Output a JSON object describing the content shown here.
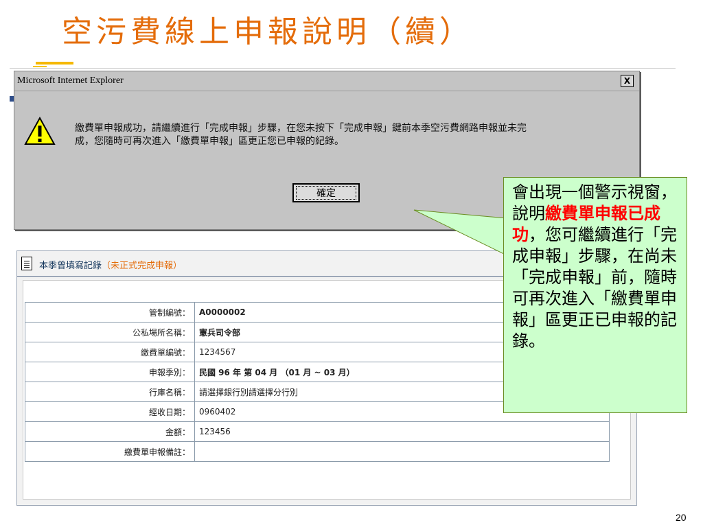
{
  "slide": {
    "title": "空污費線上申報說明（續）",
    "page_number": "20"
  },
  "dialog": {
    "title": "Microsoft Internet Explorer",
    "close_label": "X",
    "message_line1": "繳費單申報成功，請繼續進行「完成申報」步驟，在您未按下「完成申報」鍵前本季空污費網路申報並未完",
    "message_line2": "成，您隨時可再次進入「繳費單申報」區更正您已申報的紀錄。",
    "ok_label": "確定",
    "icon": "warning-icon"
  },
  "panel": {
    "title": "本季曾填寫記錄",
    "title_note": "（未正式完成申報）",
    "icon": "document-icon",
    "rows": [
      {
        "label": "管制編號：",
        "value": "A0000002"
      },
      {
        "label": "公私場所名稱：",
        "value": "憲兵司令部"
      },
      {
        "label": "繳費單編號：",
        "value": "1234567"
      },
      {
        "label": "申報季別：",
        "value": "民國 96 年 第 04 月 （01 月 ~ 03 月）"
      },
      {
        "label": "行庫名稱：",
        "value": "請選擇銀行別請選擇分行別"
      },
      {
        "label": "經收日期：",
        "value": "0960402"
      },
      {
        "label": "金額：",
        "value": "123456"
      },
      {
        "label": "繳費單申報備註：",
        "value": ""
      }
    ]
  },
  "callout": {
    "text_before": "會出現一個警示視窗，說明",
    "text_highlight": "繳費單申報已成功",
    "text_after": "，您可繼續進行「完成申報」步驟，在尚未「完成申報」前，隨時可再次進入「繳費單申報」區更正已申報的記錄。"
  },
  "colors": {
    "title": "#e46c0a",
    "callout_bg": "#ccffcc",
    "highlight": "#ff0000"
  }
}
